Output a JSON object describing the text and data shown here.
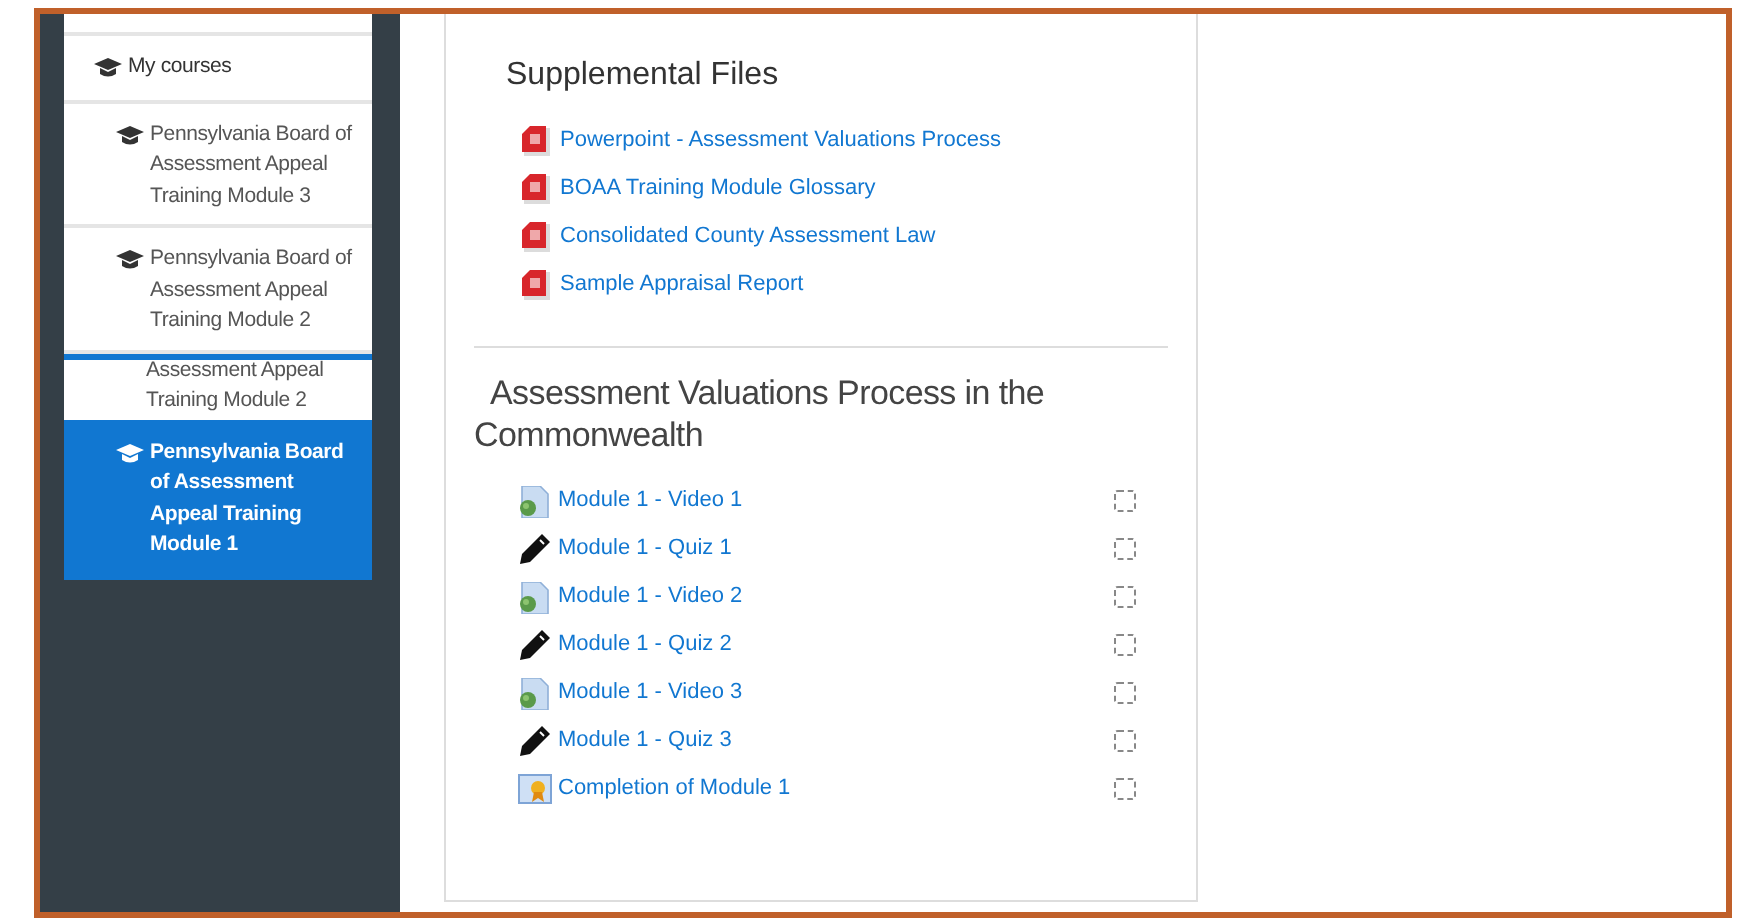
{
  "sidebar": {
    "items": [
      {
        "kind": "heading",
        "label": "My courses",
        "selected": false
      },
      {
        "kind": "course",
        "label": "Pennsylvania Board of Assessment Appeal Training Module 3",
        "selected": false
      },
      {
        "kind": "course",
        "label": "Pennsylvania Board of Assessment Appeal Training Module 2",
        "selected": false
      },
      {
        "kind": "ghost",
        "label": "Assessment Appeal Training Module 2",
        "selected": false
      },
      {
        "kind": "course",
        "label": "Pennsylvania Board of Assessment Appeal Training Module 1",
        "selected": true
      }
    ]
  },
  "supplemental": {
    "title": "Supplemental Files",
    "files": [
      "Powerpoint - Assessment Valuations Process",
      "BOAA Training Module Glossary",
      "Consolidated County Assessment Law",
      "Sample Appraisal Report"
    ]
  },
  "section": {
    "title": "Assessment Valuations Process in the Commonwealth",
    "activities": [
      {
        "kind": "video",
        "label": "Module 1 - Video 1",
        "checked": false
      },
      {
        "kind": "quiz",
        "label": "Module 1 - Quiz 1",
        "checked": false
      },
      {
        "kind": "video",
        "label": "Module 1 - Video 2",
        "checked": false
      },
      {
        "kind": "quiz",
        "label": "Module 1 - Quiz 2",
        "checked": false
      },
      {
        "kind": "video",
        "label": "Module 1 - Video 3",
        "checked": false
      },
      {
        "kind": "quiz",
        "label": "Module 1 - Quiz 3",
        "checked": false
      },
      {
        "kind": "certificate",
        "label": "Completion of Module 1",
        "checked": false
      }
    ]
  }
}
